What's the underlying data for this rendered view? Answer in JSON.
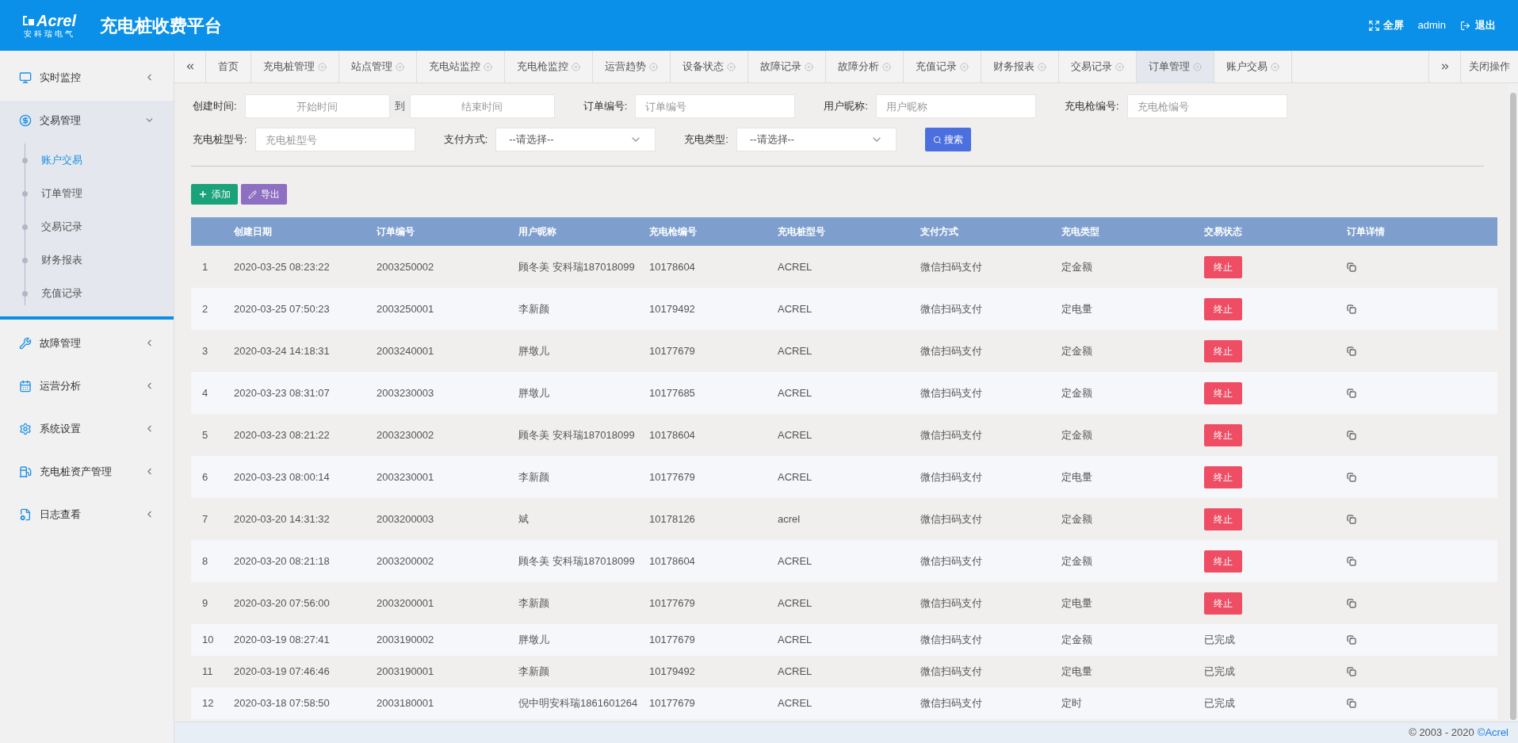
{
  "header": {
    "logo_text": "Acrel",
    "logo_subtext": "安科瑞电气",
    "title": "充电桩收费平台",
    "fullscreen": "全屏",
    "user": "admin",
    "logout": "退出"
  },
  "sidebar": {
    "items": [
      {
        "label": "实时监控",
        "expanded": false
      },
      {
        "label": "交易管理",
        "expanded": true,
        "children": [
          {
            "label": "账户交易",
            "selected": true
          },
          {
            "label": "订单管理",
            "selected": false
          },
          {
            "label": "交易记录",
            "selected": false
          },
          {
            "label": "财务报表",
            "selected": false
          },
          {
            "label": "充值记录",
            "selected": false
          }
        ]
      },
      {
        "label": "故障管理",
        "expanded": false
      },
      {
        "label": "运营分析",
        "expanded": false
      },
      {
        "label": "系统设置",
        "expanded": false
      },
      {
        "label": "充电桩资产管理",
        "expanded": false
      },
      {
        "label": "日志查看",
        "expanded": false
      }
    ]
  },
  "tabs": [
    {
      "label": "首页",
      "closable": false,
      "selected": false
    },
    {
      "label": "充电桩管理",
      "closable": true,
      "selected": false
    },
    {
      "label": "站点管理",
      "closable": true,
      "selected": false
    },
    {
      "label": "充电站监控",
      "closable": true,
      "selected": false
    },
    {
      "label": "充电枪监控",
      "closable": true,
      "selected": false
    },
    {
      "label": "运营趋势",
      "closable": true,
      "selected": false
    },
    {
      "label": "设备状态",
      "closable": true,
      "selected": false
    },
    {
      "label": "故障记录",
      "closable": true,
      "selected": false
    },
    {
      "label": "故障分析",
      "closable": true,
      "selected": false
    },
    {
      "label": "充值记录",
      "closable": true,
      "selected": false
    },
    {
      "label": "财务报表",
      "closable": true,
      "selected": false
    },
    {
      "label": "交易记录",
      "closable": true,
      "selected": false
    },
    {
      "label": "订单管理",
      "closable": true,
      "selected": true
    },
    {
      "label": "账户交易",
      "closable": true,
      "selected": false
    }
  ],
  "close_operations": "关闭操作",
  "filters": [
    [
      {
        "kind": "range",
        "label": "创建时间:",
        "placeholder": "开始时间",
        "separator": "到",
        "placeholder_2": "结束时间"
      },
      {
        "kind": "text",
        "label": "订单编号:",
        "placeholder": "订单编号"
      },
      {
        "kind": "text",
        "label": "用户昵称:",
        "placeholder": "用户昵称"
      },
      {
        "kind": "text",
        "label": "充电枪编号:",
        "placeholder": "充电枪编号"
      }
    ],
    [
      {
        "kind": "text",
        "label": "充电桩型号:",
        "placeholder": "充电桩型号"
      },
      {
        "kind": "select",
        "label": "支付方式:",
        "value": "--请选择--"
      },
      {
        "kind": "select",
        "label": "充电类型:",
        "value": "--请选择--"
      }
    ]
  ],
  "search_button": "搜索",
  "actions": [
    {
      "label": "添加",
      "kind": "add"
    },
    {
      "label": "导出",
      "kind": "export"
    }
  ],
  "table": {
    "columns": [
      "",
      "创建日期",
      "订单编号",
      "用户昵称",
      "充电枪编号",
      "充电桩型号",
      "支付方式",
      "充电类型",
      "交易状态",
      "订单详情"
    ],
    "rows": [
      {
        "no": "1",
        "date": "2020-03-25 08:23:22",
        "order": "2003250002",
        "user": "顾冬美  安科瑞187018099",
        "gun": "10178604",
        "model": "ACREL",
        "pay": "微信扫码支付",
        "type": "定金额",
        "status": {
          "kind": "button",
          "text": "终止"
        }
      },
      {
        "no": "2",
        "date": "2020-03-25 07:50:23",
        "order": "2003250001",
        "user": "李新颜",
        "gun": "10179492",
        "model": "ACREL",
        "pay": "微信扫码支付",
        "type": "定电量",
        "status": {
          "kind": "button",
          "text": "终止"
        }
      },
      {
        "no": "3",
        "date": "2020-03-24 14:18:31",
        "order": "2003240001",
        "user": "胖墩儿",
        "gun": "10177679",
        "model": "ACREL",
        "pay": "微信扫码支付",
        "type": "定金额",
        "status": {
          "kind": "button",
          "text": "终止"
        }
      },
      {
        "no": "4",
        "date": "2020-03-23 08:31:07",
        "order": "2003230003",
        "user": "胖墩儿",
        "gun": "10177685",
        "model": "ACREL",
        "pay": "微信扫码支付",
        "type": "定金额",
        "status": {
          "kind": "button",
          "text": "终止"
        }
      },
      {
        "no": "5",
        "date": "2020-03-23 08:21:22",
        "order": "2003230002",
        "user": "顾冬美  安科瑞187018099",
        "gun": "10178604",
        "model": "ACREL",
        "pay": "微信扫码支付",
        "type": "定金额",
        "status": {
          "kind": "button",
          "text": "终止"
        }
      },
      {
        "no": "6",
        "date": "2020-03-23 08:00:14",
        "order": "2003230001",
        "user": "李新颜",
        "gun": "10177679",
        "model": "ACREL",
        "pay": "微信扫码支付",
        "type": "定电量",
        "status": {
          "kind": "button",
          "text": "终止"
        }
      },
      {
        "no": "7",
        "date": "2020-03-20 14:31:32",
        "order": "2003200003",
        "user": "斌",
        "gun": "10178126",
        "model": "acrel",
        "pay": "微信扫码支付",
        "type": "定金额",
        "status": {
          "kind": "button",
          "text": "终止"
        }
      },
      {
        "no": "8",
        "date": "2020-03-20 08:21:18",
        "order": "2003200002",
        "user": "顾冬美  安科瑞187018099",
        "gun": "10178604",
        "model": "ACREL",
        "pay": "微信扫码支付",
        "type": "定金额",
        "status": {
          "kind": "button",
          "text": "终止"
        }
      },
      {
        "no": "9",
        "date": "2020-03-20 07:56:00",
        "order": "2003200001",
        "user": "李新颜",
        "gun": "10177679",
        "model": "ACREL",
        "pay": "微信扫码支付",
        "type": "定电量",
        "status": {
          "kind": "button",
          "text": "终止"
        }
      },
      {
        "no": "10",
        "date": "2020-03-19 08:27:41",
        "order": "2003190002",
        "user": "胖墩儿",
        "gun": "10177679",
        "model": "ACREL",
        "pay": "微信扫码支付",
        "type": "定金额",
        "status": {
          "kind": "text",
          "text": "已完成"
        }
      },
      {
        "no": "11",
        "date": "2020-03-19 07:46:46",
        "order": "2003190001",
        "user": "李新颜",
        "gun": "10179492",
        "model": "ACREL",
        "pay": "微信扫码支付",
        "type": "定电量",
        "status": {
          "kind": "text",
          "text": "已完成"
        }
      },
      {
        "no": "12",
        "date": "2020-03-18 07:58:50",
        "order": "2003180001",
        "user": "倪中明安科瑞1861601264",
        "gun": "10177679",
        "model": "ACREL",
        "pay": "微信扫码支付",
        "type": "定时",
        "status": {
          "kind": "text",
          "text": "已完成"
        }
      }
    ]
  },
  "footer": {
    "text": "© 2003 - 2020",
    "link": "©Acrel"
  }
}
